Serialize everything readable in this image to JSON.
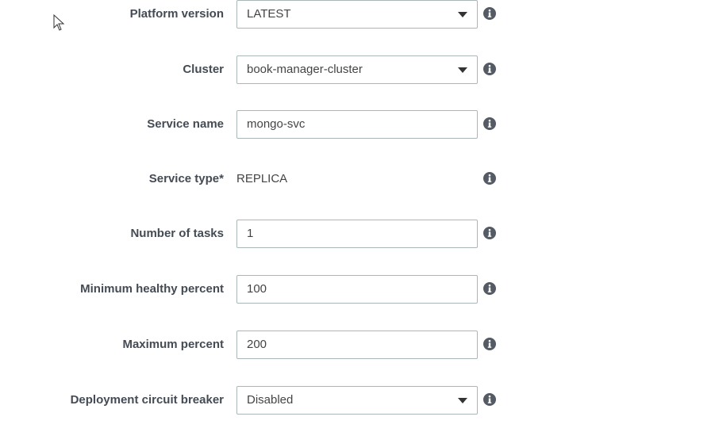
{
  "form": {
    "fields": [
      {
        "label": "Platform version",
        "value": "LATEST",
        "type": "select",
        "info_icon": "info-icon"
      },
      {
        "label": "Cluster",
        "value": "book-manager-cluster",
        "type": "select",
        "info_icon": "info-icon"
      },
      {
        "label": "Service name",
        "value": "mongo-svc",
        "type": "text",
        "info_icon": "info-icon"
      },
      {
        "label": "Service type*",
        "value": "REPLICA",
        "type": "static",
        "info_icon": "info-icon"
      },
      {
        "label": "Number of tasks",
        "value": "1",
        "type": "text",
        "info_icon": "info-icon"
      },
      {
        "label": "Minimum healthy percent",
        "value": "100",
        "type": "text",
        "info_icon": "info-icon"
      },
      {
        "label": "Maximum percent",
        "value": "200",
        "type": "text",
        "info_icon": "info-icon"
      },
      {
        "label": "Deployment circuit breaker",
        "value": "Disabled",
        "type": "select",
        "info_icon": "info-icon"
      }
    ]
  },
  "colors": {
    "label": "#444b54",
    "value_text": "#444444",
    "control_border": "#aab7b8",
    "info_icon": "#545b64"
  }
}
